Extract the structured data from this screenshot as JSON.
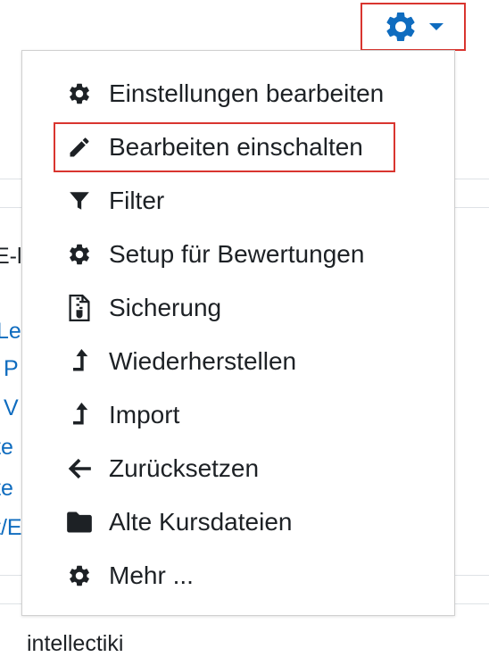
{
  "background": {
    "fragments": [
      "E-l",
      "Lel",
      "P",
      "V",
      "te",
      "te",
      "t/E",
      "intellectiki"
    ]
  },
  "trigger": {
    "icon": "gear-icon",
    "caret_icon": "caret-down-icon",
    "color": "#0f6cbf",
    "highlight_color": "#d9352f"
  },
  "menu": {
    "items": [
      {
        "label": "Einstellungen bearbeiten",
        "icon": "gear-icon"
      },
      {
        "label": "Bearbeiten einschalten",
        "icon": "pencil-icon",
        "highlighted": true
      },
      {
        "label": "Filter",
        "icon": "filter-icon"
      },
      {
        "label": "Setup für Bewertungen",
        "icon": "gear-icon"
      },
      {
        "label": "Sicherung",
        "icon": "file-archive-icon"
      },
      {
        "label": "Wiederherstellen",
        "icon": "level-up-icon"
      },
      {
        "label": "Import",
        "icon": "level-up-icon"
      },
      {
        "label": "Zurücksetzen",
        "icon": "arrow-left-icon"
      },
      {
        "label": "Alte Kursdateien",
        "icon": "folder-icon"
      },
      {
        "label": "Mehr ...",
        "icon": "gear-icon"
      }
    ]
  }
}
